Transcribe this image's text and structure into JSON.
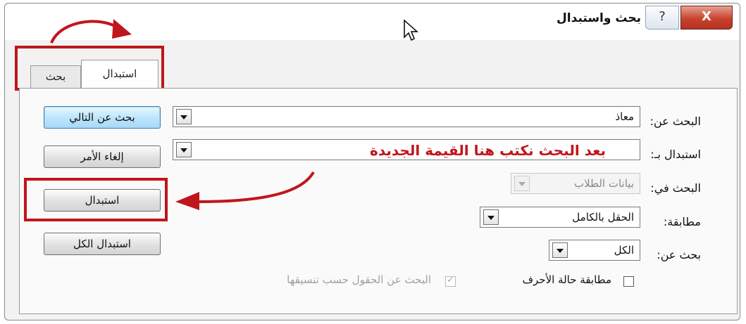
{
  "window": {
    "title": "بحث واستبدال",
    "help_label": "?",
    "close_label": "X"
  },
  "tabs": [
    {
      "label": "بحث",
      "selected": false
    },
    {
      "label": "استبدال",
      "selected": true
    }
  ],
  "form": {
    "find_label": "البحث عن:",
    "find_value": "معاذ",
    "replace_label": "استبدال بـ:",
    "replace_value": "",
    "replace_annotation": "بعد البحث نكتب هنا القيمة الجديدة",
    "lookin_label": "البحث في:",
    "lookin_value": "بيانات الطلاب",
    "match_label": "مطابقة:",
    "match_value": "الحقل بالكامل",
    "search_label": "بحث عن:",
    "search_value": "الكل",
    "match_case_label": "مطابقة حالة الأحرف",
    "match_case_checked": false,
    "search_formatted_label": "البحث عن الحقول حسب تنسيقها",
    "search_formatted_checked": true
  },
  "buttons": {
    "find_next": "بحث عن التالي",
    "cancel": "إلغاء الأمر",
    "replace": "استبدال",
    "replace_all": "استبدال الكل"
  },
  "colors": {
    "annotation_red": "#c0161b",
    "primary_button": "#bee6fd",
    "close_button": "#c8432e"
  }
}
